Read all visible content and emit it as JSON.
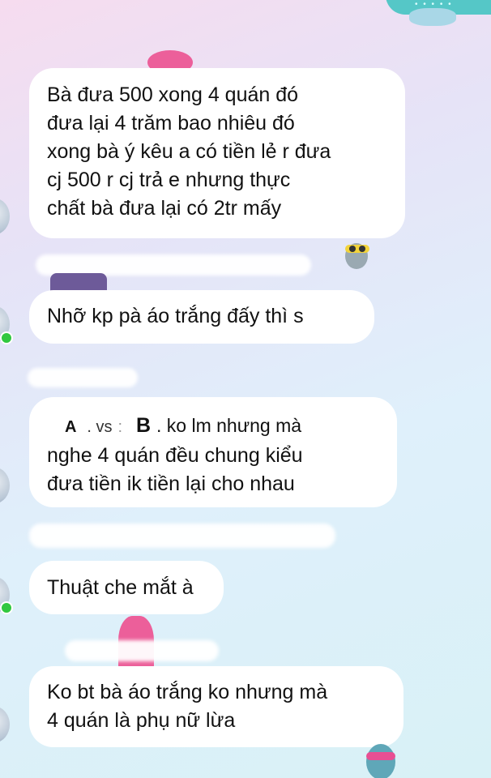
{
  "messages": [
    {
      "lines": [
        "Bà đưa 500 xong 4 quán đó",
        "đưa lại 4 trăm bao nhiêu đó",
        "xong bà ý kêu a có tiền lẻ r đưa",
        "cj 500 r cj trả e nhưng thực",
        "chất bà đưa lại có 2tr mấy"
      ]
    },
    {
      "lines": [
        "Nhỡ kp pà áo trắng đấy thì s"
      ]
    },
    {
      "first_line": {
        "name_a": "A",
        "sep1": ". vs",
        "sep2": ":",
        "name_b": "B",
        "rest": ". ko lm nhưng mà"
      },
      "lines": [
        "nghe 4 quán đều chung kiểu",
        "đưa tiền ik tiền lại cho nhau"
      ]
    },
    {
      "lines": [
        "Thuật che mắt à"
      ]
    },
    {
      "lines": [
        "Ko bt bà áo trắng ko nhưng mà",
        "4 quán là phụ nữ lừa"
      ]
    }
  ],
  "top_bubble_dots": "• • • • •",
  "colors": {
    "bubble": "#ffffff",
    "online": "#31c83f",
    "top_bubble": "#55c7c7",
    "troll_pink": "#ec5f9a"
  }
}
